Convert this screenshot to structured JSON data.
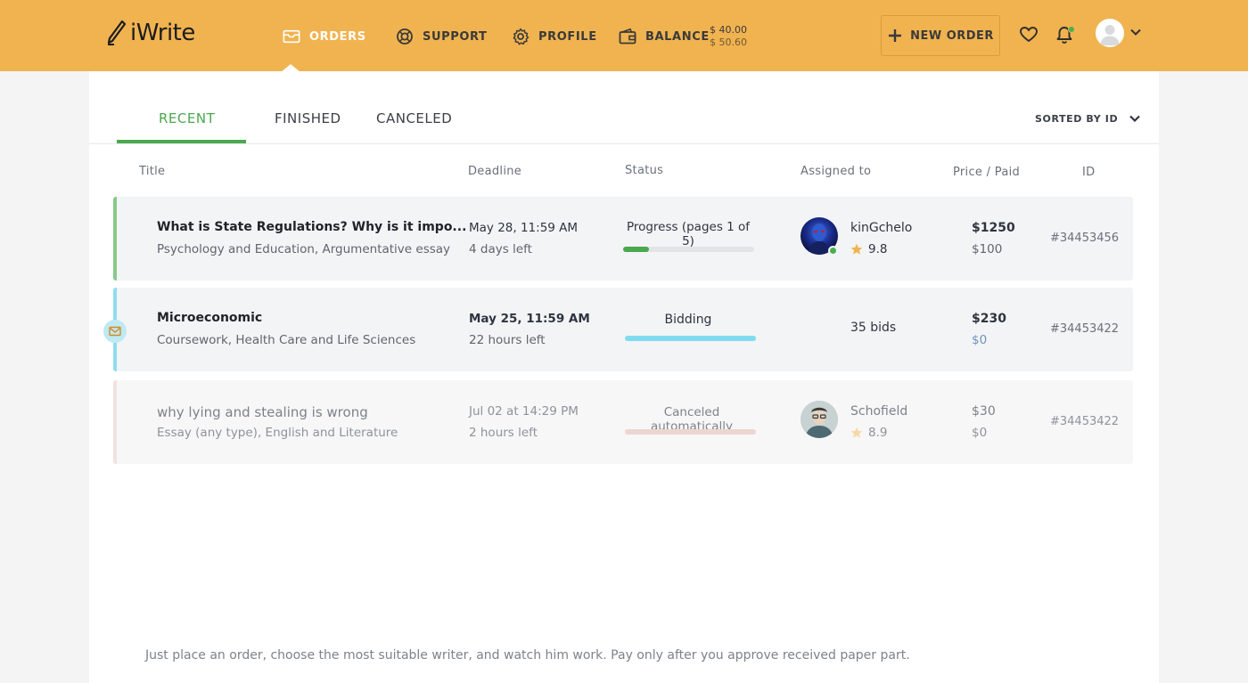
{
  "app": {
    "logo_text": "iWrite"
  },
  "nav": {
    "orders": "ORDERS",
    "support": "SUPPORT",
    "profile": "PROFILE",
    "balance": "BALANCE",
    "balance_primary": "$ 40.00",
    "balance_secondary": "$ 50.60"
  },
  "header": {
    "new_order": "NEW ORDER"
  },
  "tabs": {
    "recent": "RECENT",
    "finished": "FINISHED",
    "canceled": "CANCELED",
    "active_tab": "RECENT"
  },
  "sort": {
    "label": "SORTED BY ID"
  },
  "columns": {
    "title": "Title",
    "deadline": "Deadline",
    "status": "Status",
    "assigned": "Assigned to",
    "price": "Price / Paid",
    "id": "ID"
  },
  "orders": [
    {
      "title": "What is State Regulations? Why is it impo...",
      "subtitle": "Psychology and Education, Argumentative essay",
      "deadline": "May 28, 11:59 AM",
      "time_left": "4 days left",
      "status": "Progress (pages 1 of 5)",
      "progress": 0.2,
      "writer": "kinGchelo",
      "rating": "9.8",
      "price": "$1250",
      "paid": "$100",
      "id": "#34453456"
    },
    {
      "title": "Microeconomic",
      "subtitle": "Coursework, Health Care and Life Sciences",
      "deadline": "May 25, 11:59 AM",
      "time_left": "22 hours left",
      "status": "Bidding",
      "progress": 1.0,
      "bids": "35 bids",
      "price": "$230",
      "paid": "$0",
      "id": "#34453422"
    },
    {
      "title": "why lying and stealing is wrong",
      "subtitle": "Essay (any type), English and Literature",
      "deadline": "Jul 02 at 14:29 PM",
      "time_left": "2 hours left",
      "status": "Canceled automatically",
      "progress": 1.0,
      "writer": "Schofield",
      "rating": "8.9",
      "price": "$30",
      "paid": "$0",
      "id": "#34453422"
    }
  ],
  "colors": {
    "header": "#f0b350",
    "active_green": "#4aa84e",
    "bidding_cyan": "#7fdcf0",
    "canceled_pink": "#ecd6d0"
  },
  "footer": {
    "note": "Just place an order, choose the most suitable writer, and watch him work. Pay only after you approve received paper part."
  }
}
